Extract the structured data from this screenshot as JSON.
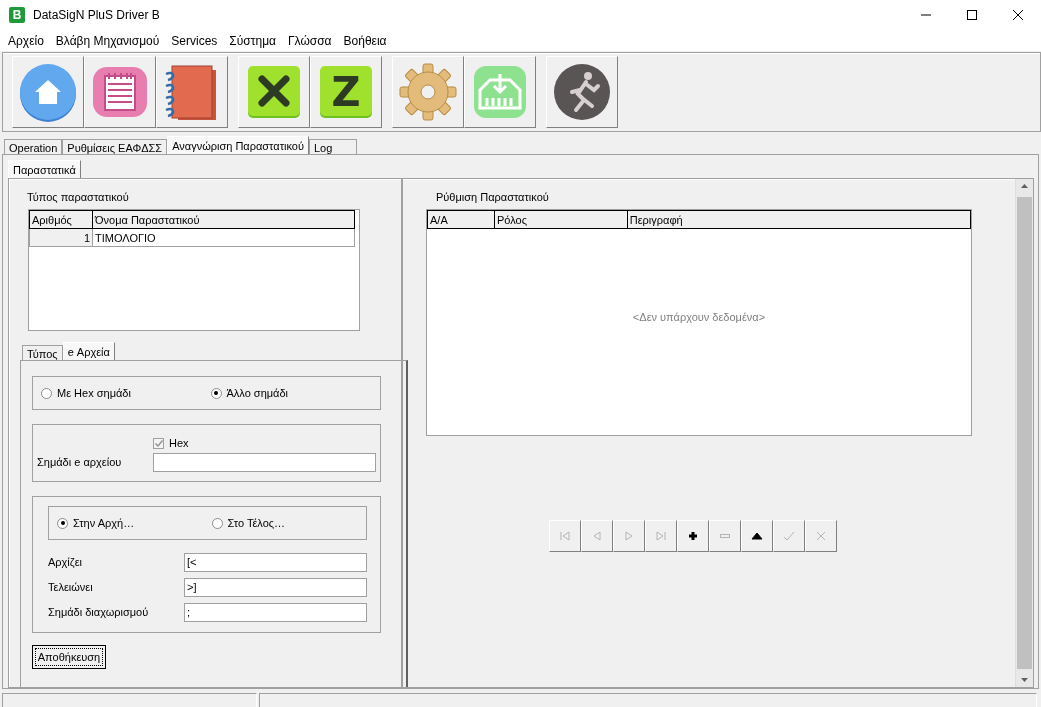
{
  "window": {
    "title": "DataSigN PluS Driver B",
    "logo": "B"
  },
  "menu": [
    "Αρχείο",
    "Βλάβη Μηχανισμού",
    "Services",
    "Σύστημα",
    "Γλώσσα",
    "Βοήθεια"
  ],
  "toolbar": [
    [
      {
        "kind": "home"
      },
      {
        "kind": "list"
      },
      {
        "kind": "notebook"
      }
    ],
    [
      {
        "kind": "cancel"
      },
      {
        "kind": "z",
        "glyph": "Z"
      }
    ],
    [
      {
        "kind": "settings"
      },
      {
        "kind": "download"
      }
    ],
    [
      {
        "kind": "runner"
      }
    ]
  ],
  "tabs": [
    {
      "label": "Operation",
      "selected": false
    },
    {
      "label": "Ρυθμίσεις ΕΑΦΔΣΣ",
      "selected": false
    },
    {
      "label": "Αναγνώριση Παραστατικού",
      "selected": true
    },
    {
      "label": "Log",
      "selected": false
    }
  ],
  "subtabs": [
    {
      "label": "Παραστατικά",
      "selected": true
    }
  ],
  "doc_types": {
    "title": "Τύπος παραστατικού",
    "columns": [
      "Αριθμός",
      "Όνομα Παραστατικού"
    ],
    "rows": [
      [
        "1",
        "ΤΙΜΟΛΟΓΙΟ"
      ]
    ]
  },
  "settings_tabs": [
    {
      "label": "Τύπος",
      "selected": false
    },
    {
      "label": "e Αρχεία",
      "selected": true
    }
  ],
  "mark_type": [
    {
      "label": "Με Hex σημάδι",
      "selected": false
    },
    {
      "label": "Άλλο σημάδι",
      "selected": true
    }
  ],
  "hex": {
    "label": "Hex",
    "checked": true,
    "disabled": true
  },
  "file_mark": {
    "label": "Σημάδι e αρχείου"
  },
  "position": [
    {
      "label": "Στην Αρχή…",
      "selected": true
    },
    {
      "label": "Στο Τέλος…",
      "selected": false
    }
  ],
  "fields": [
    {
      "label": "Αρχίζει",
      "value": "[<"
    },
    {
      "label": "Τελειώνει",
      "value": ">]"
    },
    {
      "label": "Σημάδι διαχωρισμού",
      "value": ";"
    }
  ],
  "save_button": "Αποθήκευση",
  "doc_setup": {
    "title": "Ρύθμιση Παραστατικού",
    "columns": [
      "Α/Α",
      "Ρόλος",
      "Περιγραφή"
    ],
    "empty_text": "<Δεν υπάρχουν δεδομένα>"
  },
  "navigator": [
    {
      "kind": "first",
      "disabled": true
    },
    {
      "kind": "prev",
      "disabled": true
    },
    {
      "kind": "next",
      "disabled": true
    },
    {
      "kind": "last",
      "disabled": true
    },
    {
      "kind": "add",
      "disabled": false
    },
    {
      "kind": "delete",
      "disabled": true
    },
    {
      "kind": "up",
      "disabled": false
    },
    {
      "kind": "check",
      "disabled": true
    },
    {
      "kind": "cancel",
      "disabled": true
    }
  ]
}
